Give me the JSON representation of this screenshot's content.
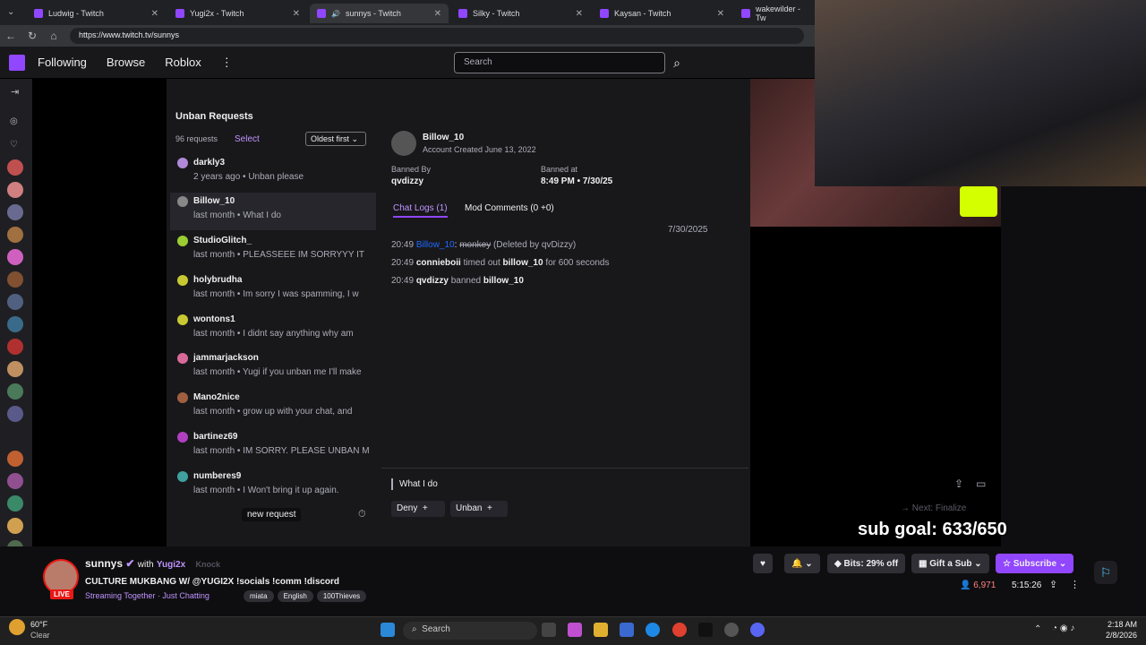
{
  "tabs": [
    {
      "label": "Ludwig - Twitch"
    },
    {
      "label": "Yugi2x - Twitch"
    },
    {
      "label": "sunnys - Twitch"
    },
    {
      "label": "Silky - Twitch"
    },
    {
      "label": "Kaysan - Twitch"
    },
    {
      "label": "wakewilder - Tw"
    }
  ],
  "url": "https://www.twitch.tv/sunnys",
  "nav": {
    "following": "Following",
    "browse": "Browse",
    "roblox": "Roblox",
    "search_placeholder": "Search"
  },
  "stream": {
    "panel_title": "Unban Requests",
    "request_count": "96 requests",
    "select": "Select",
    "sort": "Oldest first",
    "requests": [
      {
        "name": "darkly3",
        "meta": "2 years ago • Unban please",
        "color": "#b08ad8"
      },
      {
        "name": "Billow_10",
        "meta": "last month • What I do",
        "color": "#888888"
      },
      {
        "name": "StudioGlitch_",
        "meta": "last month • PLEASSEEE IM SORRYYY IT",
        "color": "#9acd32"
      },
      {
        "name": "holybrudha",
        "meta": "last month • Im sorry I was spamming, I w",
        "color": "#c8c832"
      },
      {
        "name": "wontons1",
        "meta": "last month • I didnt say anything why am",
        "color": "#c8c832"
      },
      {
        "name": "jammarjackson",
        "meta": "last month • Yugi if you unban me I'll make",
        "color": "#d86a9a"
      },
      {
        "name": "Mano2nice",
        "meta": "last month • grow up with your chat, and",
        "color": "#a06040"
      },
      {
        "name": "bartinez69",
        "meta": "last month • IM SORRY. PLEASE UNBAN M",
        "color": "#b040c0"
      },
      {
        "name": "numberes9",
        "meta": "last month • I Won't bring it up again.",
        "color": "#40a0a0"
      }
    ],
    "new_request": "new request",
    "detail": {
      "user": "Billow_10",
      "created": "Account Created June 13, 2022",
      "banned_by_label": "Banned By",
      "banned_by": "qvdizzy",
      "banned_at_label": "Banned at",
      "banned_at": "8:49 PM • 7/30/25",
      "tab_logs": "Chat Logs (1)",
      "tab_comments": "Mod Comments (0 +0)",
      "date": "7/30/2025",
      "log1_time": "20:49",
      "log1_user": "Billow_10",
      "log1_msg": "monkey",
      "log1_note": "(Deleted by qvDizzy)",
      "log2_time": "20:49",
      "log2_user": "connieboii",
      "log2_mid": "timed out",
      "log2_target": "billow_10",
      "log2_end": "for 600 seconds",
      "log3_time": "20:49",
      "log3_user": "qvdizzy",
      "log3_mid": "banned",
      "log3_target": "billow_10",
      "reason": "What I do",
      "deny": "Deny",
      "unban": "Unban",
      "next": "Next: Finalize"
    },
    "sub_goal": "sub goal: 633/650"
  },
  "channel": {
    "name": "sunnys",
    "with": "with",
    "partner": "Yugi2x",
    "knock": "Knock",
    "title": "CULTURE MUKBANG W/ @YUGI2X",
    "title_extra": "!socials !comm !discord",
    "streaming": "Streaming Together · Just Chatting",
    "tags": [
      "miata",
      "English",
      "100Thieves"
    ],
    "live": "LIVE",
    "bits": "Bits: 29% off",
    "gift": "Gift a Sub",
    "subscribe": "Subscribe",
    "viewers": "6,971",
    "uptime": "5:15:26"
  },
  "taskbar": {
    "temp": "60°F",
    "weather": "Clear",
    "search": "Search",
    "time": "2:18 AM",
    "date": "2/8/2026"
  },
  "colors": {
    "accent": "#9146ff",
    "live": "#e91916",
    "link": "#1f69ff"
  }
}
